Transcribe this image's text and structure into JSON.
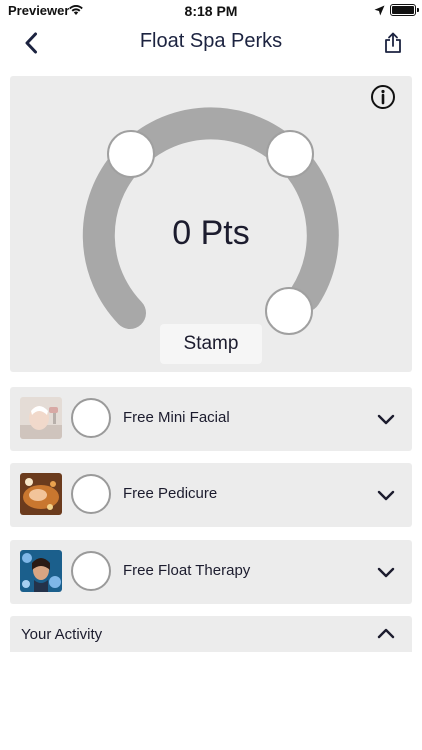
{
  "status_bar": {
    "carrier": "Previewer",
    "time": "8:18 PM"
  },
  "nav": {
    "title": "Float Spa Perks",
    "back_icon": "chevron-left-icon",
    "share_icon": "share-icon"
  },
  "points_card": {
    "points_text": "0 Pts",
    "stamp_label": "Stamp",
    "info_icon": "info-icon",
    "stamps_total": 3,
    "stamps_filled": 0
  },
  "perks": [
    {
      "label": "Free Mini Facial",
      "thumb": "facial-thumbnail"
    },
    {
      "label": "Free Pedicure",
      "thumb": "pedicure-thumbnail"
    },
    {
      "label": "Free Float Therapy",
      "thumb": "float-therapy-thumbnail"
    }
  ],
  "activity": {
    "label": "Your Activity",
    "expanded": true
  },
  "colors": {
    "card_bg": "#ececec",
    "gauge_track": "#a8a8a8",
    "text": "#1c1c2e"
  }
}
